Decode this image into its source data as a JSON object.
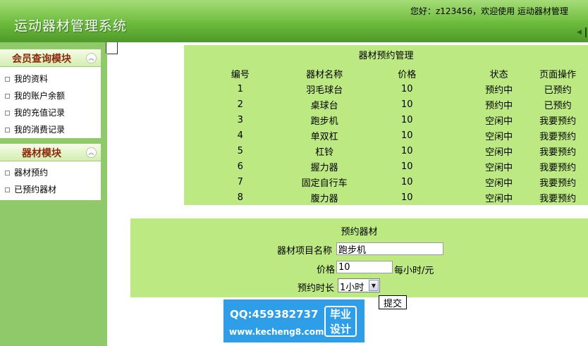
{
  "header": {
    "app_title": "运动器材管理系统",
    "welcome": "您好：z123456，欢迎使用 运动器材管理"
  },
  "sidebar": {
    "sections": [
      {
        "title": "会员查询模块",
        "items": [
          "我的资料",
          "我的账户余额",
          "我的充值记录",
          "我的消费记录"
        ]
      },
      {
        "title": "器材模块",
        "items": [
          "器材预约",
          "已预约器材"
        ]
      }
    ]
  },
  "reservation_management": {
    "caption": "器材预约管理",
    "columns": [
      "编号",
      "器材名称",
      "价格",
      "状态",
      "页面操作"
    ],
    "rows": [
      {
        "id": "1",
        "name": "羽毛球台",
        "price": "10",
        "status": "预约中",
        "action": "已预约"
      },
      {
        "id": "2",
        "name": "桌球台",
        "price": "10",
        "status": "预约中",
        "action": "已预约"
      },
      {
        "id": "3",
        "name": "跑步机",
        "price": "10",
        "status": "空闲中",
        "action": "我要预约"
      },
      {
        "id": "4",
        "name": "单双杠",
        "price": "10",
        "status": "空闲中",
        "action": "我要预约"
      },
      {
        "id": "5",
        "name": "杠铃",
        "price": "10",
        "status": "空闲中",
        "action": "我要预约"
      },
      {
        "id": "6",
        "name": "握力器",
        "price": "10",
        "status": "空闲中",
        "action": "我要预约"
      },
      {
        "id": "7",
        "name": "固定自行车",
        "price": "10",
        "status": "空闲中",
        "action": "我要预约"
      },
      {
        "id": "8",
        "name": "腹力器",
        "price": "10",
        "status": "空闲中",
        "action": "我要预约"
      }
    ]
  },
  "reserve_form": {
    "caption": "预约器材",
    "equipment_label": "器材项目名称",
    "equipment_value": "跑步机",
    "price_label": "价格",
    "price_value": "10",
    "price_unit": "每小时/元",
    "duration_label": "预约时长",
    "duration_value": "1小时",
    "submit_label": "提交"
  },
  "watermark": {
    "qq": "QQ:459382737",
    "site": "www.kecheng8.com",
    "stamp_line1": "毕业",
    "stamp_line2": "设计"
  },
  "colors": {
    "header_green": "#6cbb3c",
    "panel_green": "#bde983",
    "sidebar_green": "#8fc96a",
    "section_title": "#8b2a0a",
    "watermark_blue": "#2e9ee8"
  }
}
